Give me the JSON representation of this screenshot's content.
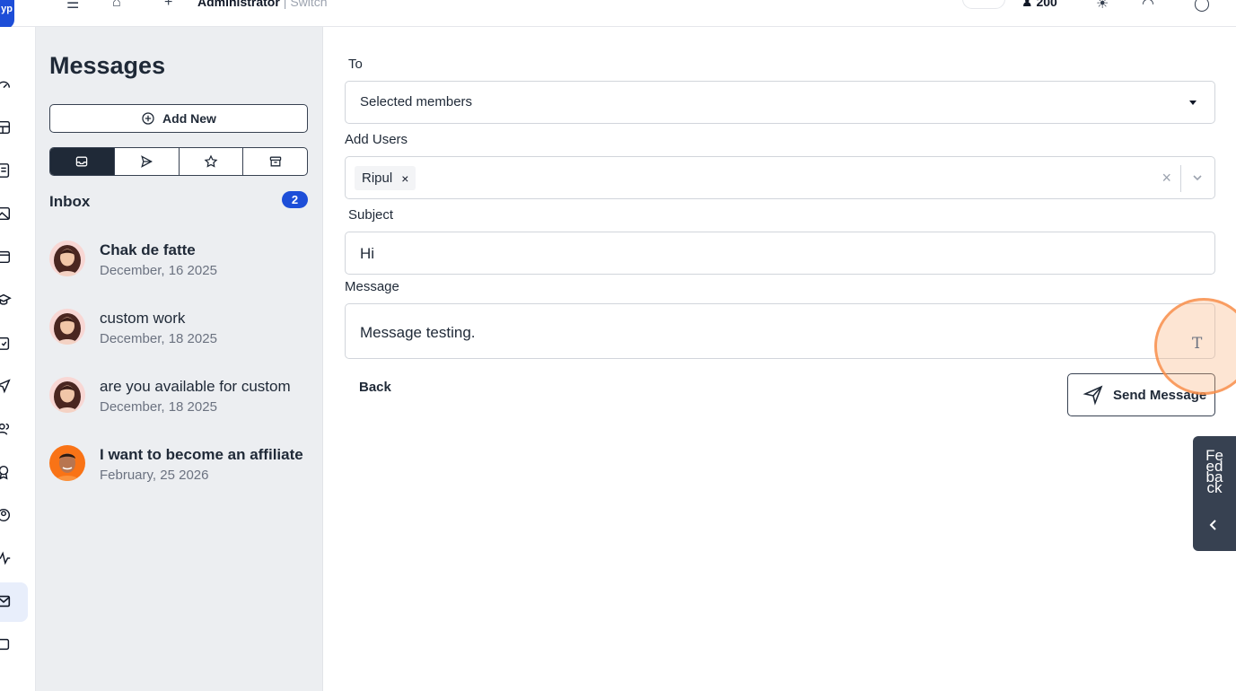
{
  "topbar": {
    "logo_text": "yp",
    "user_name": "Administrator",
    "switch_label": "| Switch",
    "points": "200"
  },
  "sidebar": {
    "icons": [
      "dashboard-icon",
      "layout-icon",
      "document-icon",
      "image-icon",
      "calendar-icon",
      "graduation-cap-icon",
      "clipboard-icon",
      "send-icon",
      "users-icon",
      "award-icon",
      "user-circle-icon",
      "activity-icon",
      "mail-icon",
      "box-icon"
    ],
    "active": "mail-icon"
  },
  "messages_panel": {
    "title": "Messages",
    "add_new_label": "Add New",
    "tabs": [
      "inbox-icon",
      "sent-icon",
      "starred-icon",
      "archive-icon"
    ],
    "active_tab": "inbox-icon",
    "inbox_label": "Inbox",
    "inbox_count": "2",
    "conversations": [
      {
        "subject": "Chak de fatte",
        "date": "December, 16 2025",
        "unread": true,
        "avatar": "woman"
      },
      {
        "subject": "custom work",
        "date": "December, 18 2025",
        "unread": false,
        "avatar": "woman"
      },
      {
        "subject": "are you available for custom",
        "date": "December, 18 2025",
        "unread": false,
        "avatar": "woman"
      },
      {
        "subject": "I want to become an affiliate",
        "date": "February, 25 2026",
        "unread": true,
        "avatar": "man"
      }
    ]
  },
  "form": {
    "to_label": "To",
    "to_value": "Selected members",
    "add_users_label": "Add Users",
    "users": [
      "Ripul"
    ],
    "subject_label": "Subject",
    "subject_value": "Hi",
    "message_label": "Message",
    "message_value": "Message testing.",
    "back_label": "Back",
    "send_label": "Send Message"
  },
  "feedback_tab": {
    "label": "Feedback"
  },
  "colors": {
    "accent": "#1d4ed8",
    "dark": "#1f2937",
    "panel_bg": "#eceef1",
    "highlight": "#f98c46"
  }
}
